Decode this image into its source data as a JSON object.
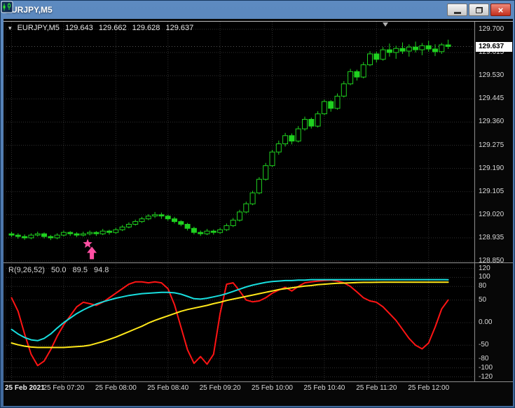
{
  "window": {
    "title": "EURJPY,M5",
    "close_glyph": "×"
  },
  "chart_header": {
    "one_click_arrow": "▾",
    "symbol": "EURJPY,M5",
    "open": "129.643",
    "high": "129.662",
    "low": "129.628",
    "close": "129.637"
  },
  "indicator_header": {
    "name": "R(9,26,52)",
    "values": [
      "50.0",
      "89.5",
      "94.8"
    ]
  },
  "chart_data": {
    "type": "candlestick",
    "symbol": "EURJPY",
    "timeframe": "M5",
    "title": "EURJPY,M5",
    "current_price": 129.637,
    "current_price_label": "129.637",
    "price_range": [
      128.845,
      129.728
    ],
    "price_ticks": [
      "129.700",
      "129.615",
      "129.530",
      "129.445",
      "129.360",
      "129.275",
      "129.190",
      "129.105",
      "129.020",
      "128.935",
      "128.850"
    ],
    "time_ticks": [
      {
        "label": "25 Feb 2021",
        "i": 0
      },
      {
        "label": "25 Feb 07:20",
        "i": 8
      },
      {
        "label": "25 Feb 08:00",
        "i": 16
      },
      {
        "label": "25 Feb 08:40",
        "i": 24
      },
      {
        "label": "25 Feb 09:20",
        "i": 32
      },
      {
        "label": "25 Feb 10:00",
        "i": 40
      },
      {
        "label": "25 Feb 10:40",
        "i": 48
      },
      {
        "label": "25 Feb 11:20",
        "i": 56
      },
      {
        "label": "25 Feb 12:00",
        "i": 64
      }
    ],
    "colors": {
      "grid": "#303030",
      "candle": "#1fd11f",
      "bull_fill": "#000000",
      "axis_text": "#d9d9d9",
      "tag_bg": "#ffffff",
      "annotation": "#ff4fa3",
      "bid_line": "#565656",
      "shift_marker": "#b0b0b0"
    },
    "candles": [
      [
        128.95,
        128.958,
        128.938,
        128.945
      ],
      [
        128.945,
        128.952,
        128.932,
        128.94
      ],
      [
        128.94,
        128.948,
        128.928,
        128.935
      ],
      [
        128.935,
        128.952,
        128.93,
        128.945
      ],
      [
        128.945,
        128.958,
        128.94,
        128.95
      ],
      [
        128.95,
        128.955,
        128.933,
        128.94
      ],
      [
        128.94,
        128.946,
        128.927,
        128.935
      ],
      [
        128.935,
        128.952,
        128.93,
        128.945
      ],
      [
        128.945,
        128.962,
        128.94,
        128.955
      ],
      [
        128.955,
        128.96,
        128.942,
        128.95
      ],
      [
        128.95,
        128.956,
        128.938,
        128.945
      ],
      [
        128.945,
        128.958,
        128.94,
        128.95
      ],
      [
        128.95,
        128.962,
        128.944,
        128.955
      ],
      [
        128.955,
        128.96,
        128.942,
        128.95
      ],
      [
        128.95,
        128.968,
        128.945,
        128.96
      ],
      [
        128.96,
        128.965,
        128.947,
        128.955
      ],
      [
        128.955,
        128.972,
        128.95,
        128.965
      ],
      [
        128.965,
        128.982,
        128.96,
        128.975
      ],
      [
        128.975,
        128.992,
        128.97,
        128.985
      ],
      [
        128.985,
        129.002,
        128.98,
        128.995
      ],
      [
        128.995,
        129.012,
        128.99,
        129.005
      ],
      [
        129.005,
        129.022,
        129.0,
        129.015
      ],
      [
        129.015,
        129.03,
        129.008,
        129.02
      ],
      [
        129.02,
        129.028,
        129.005,
        129.015
      ],
      [
        129.015,
        129.02,
        128.998,
        129.005
      ],
      [
        129.005,
        129.012,
        128.988,
        128.995
      ],
      [
        128.995,
        129.0,
        128.978,
        128.985
      ],
      [
        128.985,
        128.99,
        128.962,
        128.97
      ],
      [
        128.97,
        128.976,
        128.948,
        128.955
      ],
      [
        128.955,
        128.962,
        128.942,
        128.95
      ],
      [
        128.95,
        128.968,
        128.945,
        128.96
      ],
      [
        128.96,
        128.966,
        128.947,
        128.955
      ],
      [
        128.955,
        128.972,
        128.95,
        128.965
      ],
      [
        128.965,
        128.988,
        128.96,
        128.98
      ],
      [
        128.98,
        129.008,
        128.975,
        129.0
      ],
      [
        129.0,
        129.038,
        128.995,
        129.03
      ],
      [
        129.03,
        129.068,
        129.025,
        129.06
      ],
      [
        129.06,
        129.108,
        129.055,
        129.1
      ],
      [
        129.1,
        129.158,
        129.095,
        129.15
      ],
      [
        129.15,
        129.21,
        129.145,
        129.2
      ],
      [
        129.2,
        129.258,
        129.195,
        129.25
      ],
      [
        129.25,
        129.292,
        129.24,
        129.28
      ],
      [
        129.28,
        129.32,
        129.27,
        129.31
      ],
      [
        129.31,
        129.318,
        129.278,
        129.29
      ],
      [
        129.29,
        129.345,
        129.285,
        129.335
      ],
      [
        129.335,
        129.38,
        129.328,
        129.37
      ],
      [
        129.37,
        129.376,
        129.336,
        129.345
      ],
      [
        129.345,
        129.4,
        129.34,
        129.39
      ],
      [
        129.39,
        129.442,
        129.385,
        129.435
      ],
      [
        129.435,
        129.44,
        129.398,
        129.41
      ],
      [
        129.41,
        129.465,
        129.405,
        129.455
      ],
      [
        129.455,
        129.51,
        129.45,
        129.5
      ],
      [
        129.5,
        129.555,
        129.495,
        129.545
      ],
      [
        129.545,
        129.552,
        129.512,
        129.525
      ],
      [
        129.525,
        129.58,
        129.52,
        129.57
      ],
      [
        129.57,
        129.62,
        129.565,
        129.61
      ],
      [
        129.61,
        129.618,
        129.578,
        129.59
      ],
      [
        129.59,
        129.635,
        129.585,
        129.625
      ],
      [
        129.625,
        129.648,
        129.6,
        129.615
      ],
      [
        129.615,
        129.64,
        129.592,
        129.63
      ],
      [
        129.63,
        129.652,
        129.61,
        129.62
      ],
      [
        129.62,
        129.645,
        129.6,
        129.635
      ],
      [
        129.635,
        129.655,
        129.615,
        129.625
      ],
      [
        129.625,
        129.65,
        129.605,
        129.64
      ],
      [
        129.64,
        129.658,
        129.618,
        129.628
      ],
      [
        129.628,
        129.645,
        129.602,
        129.618
      ],
      [
        129.618,
        129.65,
        129.61,
        129.643
      ],
      [
        129.643,
        129.662,
        129.628,
        129.637
      ]
    ],
    "indicator": {
      "name": "R(9,26,52)",
      "display_values": [
        "50.0",
        "89.5",
        "94.8"
      ],
      "range": [
        -130,
        130
      ],
      "levels": [
        "120",
        "100",
        "80",
        "50",
        "0.00",
        "-50",
        "-80",
        "-100",
        "-120"
      ],
      "series": [
        {
          "name": "r9",
          "color": "#ff1414",
          "values": [
            55,
            25,
            -25,
            -70,
            -95,
            -85,
            -60,
            -30,
            -5,
            15,
            35,
            45,
            42,
            38,
            45,
            55,
            65,
            75,
            85,
            90,
            90,
            88,
            90,
            88,
            75,
            40,
            -10,
            -60,
            -90,
            -75,
            -92,
            -70,
            20,
            85,
            88,
            70,
            50,
            46,
            48,
            55,
            65,
            72,
            78,
            70,
            80,
            88,
            90,
            92,
            93,
            94,
            92,
            88,
            80,
            68,
            55,
            48,
            45,
            35,
            20,
            5,
            -15,
            -35,
            -50,
            -58,
            -45,
            -10,
            30,
            50
          ]
        },
        {
          "name": "r26",
          "color": "#18dede",
          "values": [
            -15,
            -25,
            -33,
            -38,
            -40,
            -35,
            -25,
            -12,
            0,
            10,
            20,
            28,
            35,
            41,
            46,
            50,
            54,
            57,
            60,
            62,
            64,
            65,
            66,
            67,
            67,
            66,
            63,
            58,
            53,
            52,
            54,
            57,
            60,
            64,
            69,
            74,
            79,
            83,
            86,
            89,
            91,
            92,
            93,
            93,
            94,
            94,
            95,
            95,
            95,
            95,
            95,
            95,
            95,
            95,
            95,
            95,
            95,
            95,
            95,
            95,
            95,
            95,
            95,
            95,
            95,
            95,
            95,
            94.8
          ]
        },
        {
          "name": "r52",
          "color": "#ffe81a",
          "values": [
            -45,
            -49,
            -52,
            -54,
            -55,
            -55,
            -55,
            -55,
            -55,
            -54,
            -53,
            -52,
            -50,
            -46,
            -42,
            -37,
            -32,
            -26,
            -20,
            -14,
            -8,
            -1,
            5,
            10,
            15,
            20,
            25,
            29,
            32,
            35,
            38,
            42,
            45,
            49,
            52,
            55,
            58,
            61,
            64,
            67,
            70,
            73,
            75,
            77,
            79,
            81,
            82,
            84,
            85,
            86,
            87,
            87.5,
            88,
            88.5,
            89,
            89,
            89.2,
            89.3,
            89.5,
            89.5,
            89.5,
            89.5,
            89.5,
            89.5,
            89.5,
            89.5,
            89.5,
            89.5
          ]
        }
      ]
    },
    "annotations": [
      {
        "type": "buy-signal",
        "shape": "star+up-arrow",
        "candle_index": 12,
        "color": "#ff4fa3"
      }
    ],
    "layout": {
      "candle_step": 9.3,
      "candle_width": 7,
      "shift_marker_x": 541
    }
  }
}
